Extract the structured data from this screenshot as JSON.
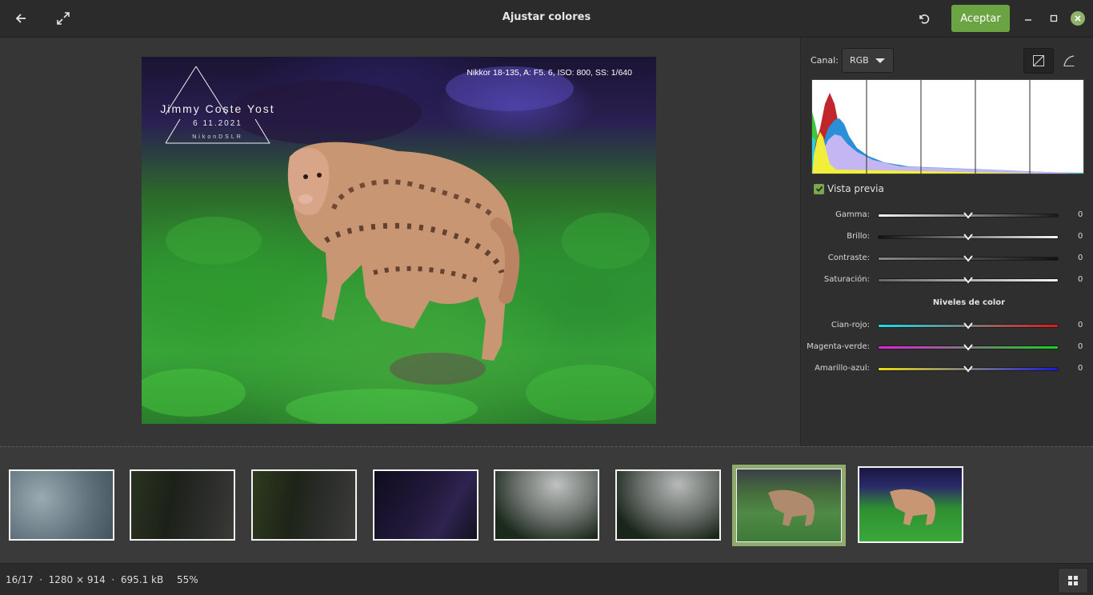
{
  "window": {
    "title": "Ajustar colores",
    "accept_label": "Aceptar"
  },
  "photo": {
    "exif_overlay": "Nikkor 18-135, A: F5. 6, ISO: 800, SS: 1/640",
    "watermark_name": "Jimmy Coste Yost",
    "watermark_date": "6 11.2021",
    "watermark_camera": "NikonDSLR"
  },
  "panel": {
    "channel_label": "Canal:",
    "channel_value": "RGB",
    "preview_label": "Vista previa",
    "preview_checked": true,
    "adjustments": [
      {
        "label": "Gamma:",
        "value": "0"
      },
      {
        "label": "Brillo:",
        "value": "0"
      },
      {
        "label": "Contraste:",
        "value": "0"
      },
      {
        "label": "Saturación:",
        "value": "0"
      }
    ],
    "color_levels_title": "Niveles de color",
    "color_levels": [
      {
        "label": "Cian-rojo:",
        "value": "0",
        "from": "#17e3ee",
        "to": "#e01818"
      },
      {
        "label": "Magenta-verde:",
        "value": "0",
        "from": "#e81fe0",
        "to": "#16d41a"
      },
      {
        "label": "Amarillo-azul:",
        "value": "0",
        "from": "#ecdd16",
        "to": "#1a1ae0"
      }
    ]
  },
  "filmstrip": {
    "selected_index": 6,
    "count_visible": 8
  },
  "status": {
    "info": "16/17  ·  1280 × 914  ·  695.1 kB",
    "zoom": "55%"
  },
  "colors": {
    "accent": "#6ba543",
    "selection": "#8fab6e"
  }
}
